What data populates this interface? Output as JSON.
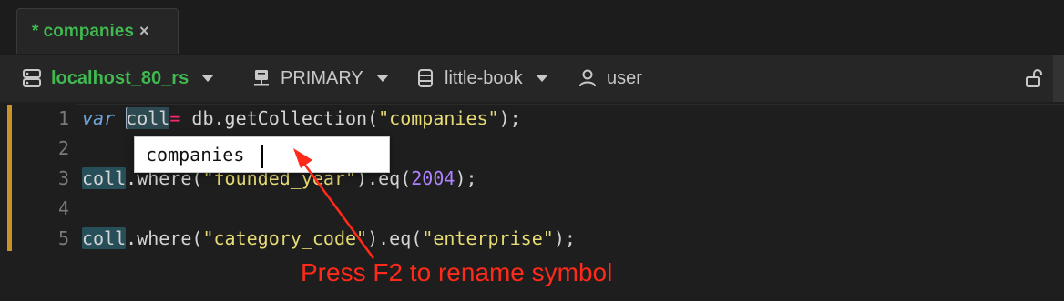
{
  "tab": {
    "label": "* companies",
    "close_glyph": "×",
    "label_color": "#3fb950"
  },
  "toolbar": {
    "connection": {
      "label": "localhost_80_rs",
      "icon": "server-icon"
    },
    "node": {
      "label": "PRIMARY",
      "icon": "server-node-icon"
    },
    "database": {
      "label": "little-book",
      "icon": "database-icon"
    },
    "user": {
      "label": "user",
      "icon": "user-icon"
    },
    "lock_icon": "unlock-icon"
  },
  "editor": {
    "line_numbers": [
      "1",
      "2",
      "3",
      "4",
      "5"
    ],
    "lines": [
      {
        "n": 1,
        "tokens": [
          [
            "kw",
            "var"
          ],
          [
            "txt",
            " "
          ],
          [
            "sym",
            "coll"
          ],
          [
            "op",
            "="
          ],
          [
            "txt",
            " db.getCollection("
          ],
          [
            "str",
            "\"companies\""
          ],
          [
            "txt",
            ");"
          ]
        ]
      },
      {
        "n": 2,
        "tokens": []
      },
      {
        "n": 3,
        "tokens": [
          [
            "sym",
            "coll"
          ],
          [
            "txt",
            ".where("
          ],
          [
            "str",
            "\"founded_year\""
          ],
          [
            "txt",
            ").eq("
          ],
          [
            "num",
            "2004"
          ],
          [
            "txt",
            ");"
          ]
        ]
      },
      {
        "n": 4,
        "tokens": []
      },
      {
        "n": 5,
        "tokens": [
          [
            "sym",
            "coll"
          ],
          [
            "txt",
            ".where("
          ],
          [
            "str",
            "\"category_code\""
          ],
          [
            "txt",
            ").eq("
          ],
          [
            "str",
            "\"enterprise\""
          ],
          [
            "txt",
            ");"
          ]
        ]
      }
    ]
  },
  "rename": {
    "value": "companies"
  },
  "annotation": {
    "text": "Press F2 to rename symbol",
    "color": "#ff2a1a"
  },
  "colors": {
    "keyword": "#6fa3d8",
    "string": "#e6db74",
    "number": "#ae81ff",
    "operator": "#f92672",
    "accent": "#c9922a"
  }
}
